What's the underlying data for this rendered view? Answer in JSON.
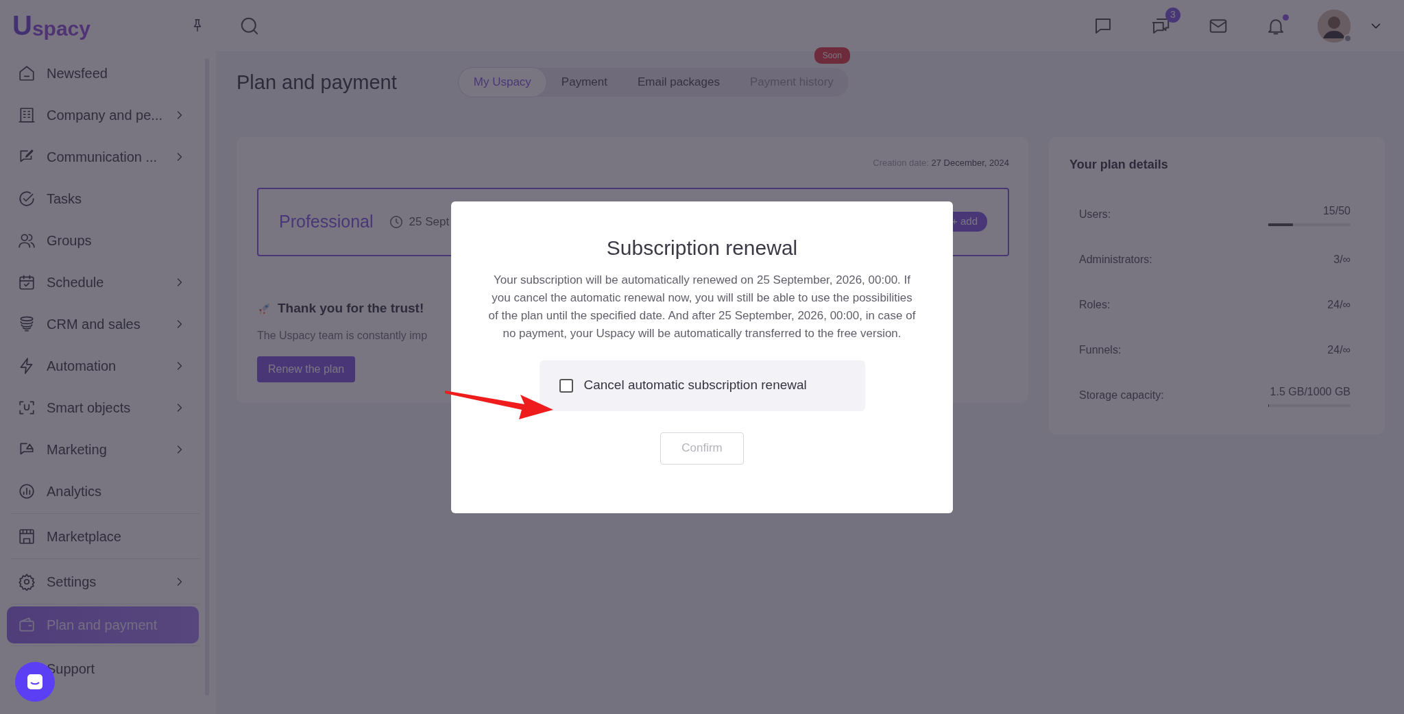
{
  "sidebar": {
    "logo": {
      "mark": "U",
      "text": "spacy"
    },
    "sections": [
      [
        {
          "label": "Newsfeed",
          "chevron": false,
          "selected": false
        },
        {
          "label": "Company and pe...",
          "chevron": true,
          "selected": false
        },
        {
          "label": "Communication ...",
          "chevron": true,
          "selected": false
        },
        {
          "label": "Tasks",
          "chevron": false,
          "selected": false
        },
        {
          "label": "Groups",
          "chevron": false,
          "selected": false
        },
        {
          "label": "Schedule",
          "chevron": true,
          "selected": false
        },
        {
          "label": "CRM and sales",
          "chevron": true,
          "selected": false
        },
        {
          "label": "Automation",
          "chevron": true,
          "selected": false
        },
        {
          "label": "Smart objects",
          "chevron": true,
          "selected": false
        },
        {
          "label": "Marketing",
          "chevron": true,
          "selected": false
        },
        {
          "label": "Analytics",
          "chevron": false,
          "selected": false
        }
      ],
      [
        {
          "label": "Marketplace",
          "chevron": false,
          "selected": false
        }
      ],
      [
        {
          "label": "Settings",
          "chevron": true,
          "selected": false
        }
      ],
      [
        {
          "label": "Plan and payment",
          "chevron": false,
          "selected": true
        }
      ],
      [
        {
          "label": "Support",
          "chevron": false,
          "selected": false
        }
      ]
    ]
  },
  "header": {
    "messages_badge": "3",
    "notifications_unread": true,
    "user_online": false
  },
  "page": {
    "title": "Plan and payment",
    "tabs": [
      {
        "label": "My Uspacy",
        "selected": true,
        "disabled": false
      },
      {
        "label": "Payment",
        "selected": false,
        "disabled": false
      },
      {
        "label": "Email packages",
        "selected": false,
        "disabled": false
      },
      {
        "label": "Payment history",
        "selected": false,
        "disabled": true,
        "badge": "Soon"
      }
    ]
  },
  "plan_card": {
    "creation_label": "Creation date:",
    "creation_date": "27 December, 2024",
    "plan_name": "Professional",
    "expiry": "25 Sept",
    "add_button": "+ add",
    "thanks_title": "Thank you for the trust!",
    "thanks_text": "The Uspacy team is constantly imp",
    "renew_button": "Renew the plan"
  },
  "plan_details": {
    "title": "Your plan details",
    "rows": [
      {
        "label": "Users:",
        "value": "15/50",
        "level": 0.3
      },
      {
        "label": "Administrators:",
        "value": "3/∞"
      },
      {
        "label": "Roles:",
        "value": "24/∞"
      },
      {
        "label": "Funnels:",
        "value": "24/∞"
      },
      {
        "label": "Storage capacity:",
        "value": "1.5 GB/1000 GB",
        "level": 0.0015
      }
    ]
  },
  "dialog": {
    "title": "Subscription renewal",
    "text": "Your subscription will be automatically renewed on 25 September, 2026, 00:00. If you cancel the automatic renewal now, you will still be able to use the possibilities of the plan until the specified date. And after 25 September, 2026, 00:00, in case of no payment, your Uspacy will be automatically transferred to the free version.",
    "checkbox": {
      "label": "Cancel automatic subscription renewal",
      "checked": false
    },
    "confirm": {
      "label": "Confirm",
      "disabled": true
    }
  }
}
